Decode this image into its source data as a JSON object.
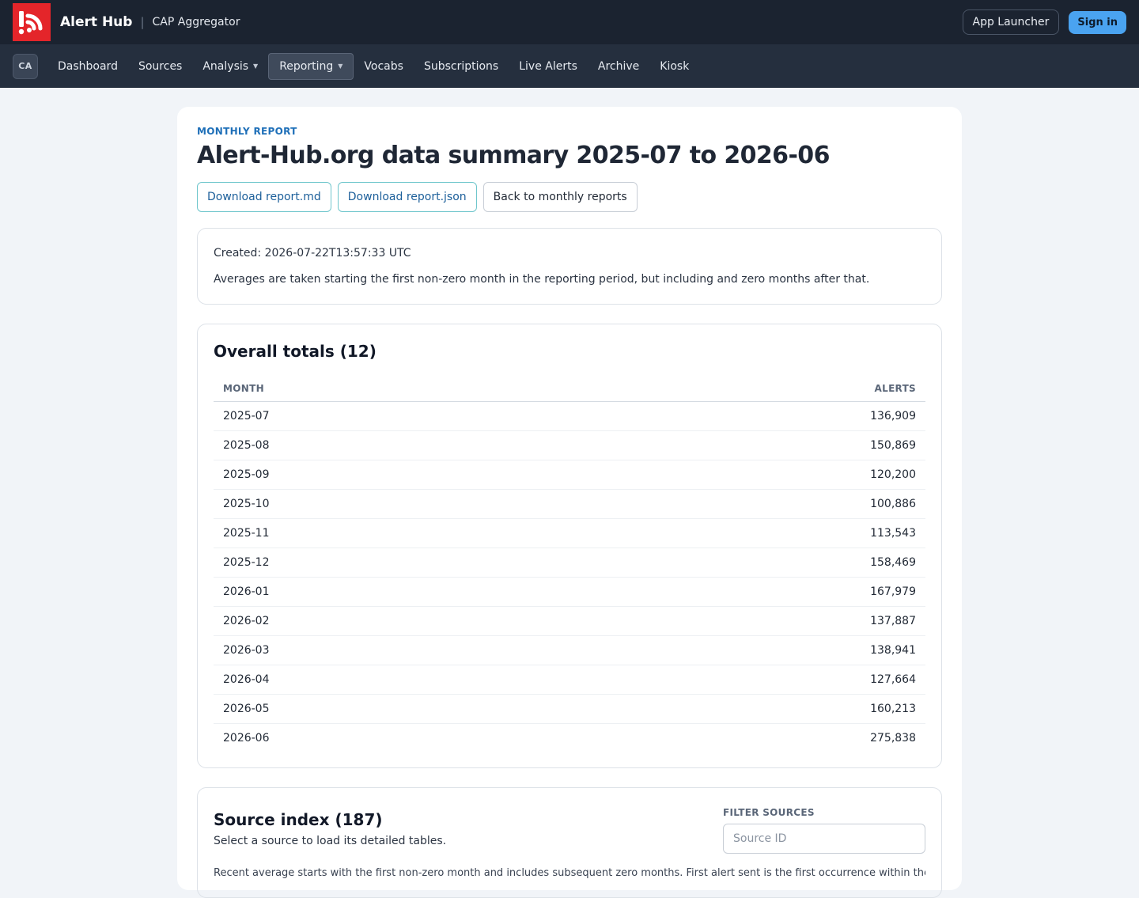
{
  "app": {
    "name": "Alert Hub",
    "subtitle": "CAP Aggregator",
    "app_launcher_label": "App Launcher",
    "sign_in_label": "Sign in"
  },
  "nav": {
    "badge": "CA",
    "items": [
      {
        "label": "Dashboard"
      },
      {
        "label": "Sources"
      },
      {
        "label": "Analysis"
      },
      {
        "label": "Reporting"
      },
      {
        "label": "Vocabs"
      },
      {
        "label": "Subscriptions"
      },
      {
        "label": "Live Alerts"
      },
      {
        "label": "Archive"
      },
      {
        "label": "Kiosk"
      }
    ]
  },
  "report": {
    "eyebrow": "MONTHLY REPORT",
    "title": "Alert-Hub.org data summary 2025-07 to 2026-06",
    "buttons": {
      "download_md": "Download report.md",
      "download_json": "Download report.json",
      "back": "Back to monthly reports"
    },
    "info": {
      "created": "Created: 2026-07-22T13:57:33 UTC",
      "note": "Averages are taken starting the first non-zero month in the reporting period, but including and zero months after that."
    }
  },
  "totals": {
    "title": "Overall totals (12)",
    "columns": {
      "month": "MONTH",
      "alerts": "ALERTS"
    },
    "rows": [
      {
        "month": "2025-07",
        "alerts": "136,909"
      },
      {
        "month": "2025-08",
        "alerts": "150,869"
      },
      {
        "month": "2025-09",
        "alerts": "120,200"
      },
      {
        "month": "2025-10",
        "alerts": "100,886"
      },
      {
        "month": "2025-11",
        "alerts": "113,543"
      },
      {
        "month": "2025-12",
        "alerts": "158,469"
      },
      {
        "month": "2026-01",
        "alerts": "167,979"
      },
      {
        "month": "2026-02",
        "alerts": "137,887"
      },
      {
        "month": "2026-03",
        "alerts": "138,941"
      },
      {
        "month": "2026-04",
        "alerts": "127,664"
      },
      {
        "month": "2026-05",
        "alerts": "160,213"
      },
      {
        "month": "2026-06",
        "alerts": "275,838"
      }
    ]
  },
  "source_index": {
    "title": "Source index (187)",
    "subtitle": "Select a source to load its detailed tables.",
    "filter_label": "FILTER SOURCES",
    "filter_placeholder": "Source ID",
    "filter_value": "",
    "note": "Recent average starts with the first non-zero month and includes subsequent zero months. First alert sent is the first occurrence within the reporting period."
  }
}
